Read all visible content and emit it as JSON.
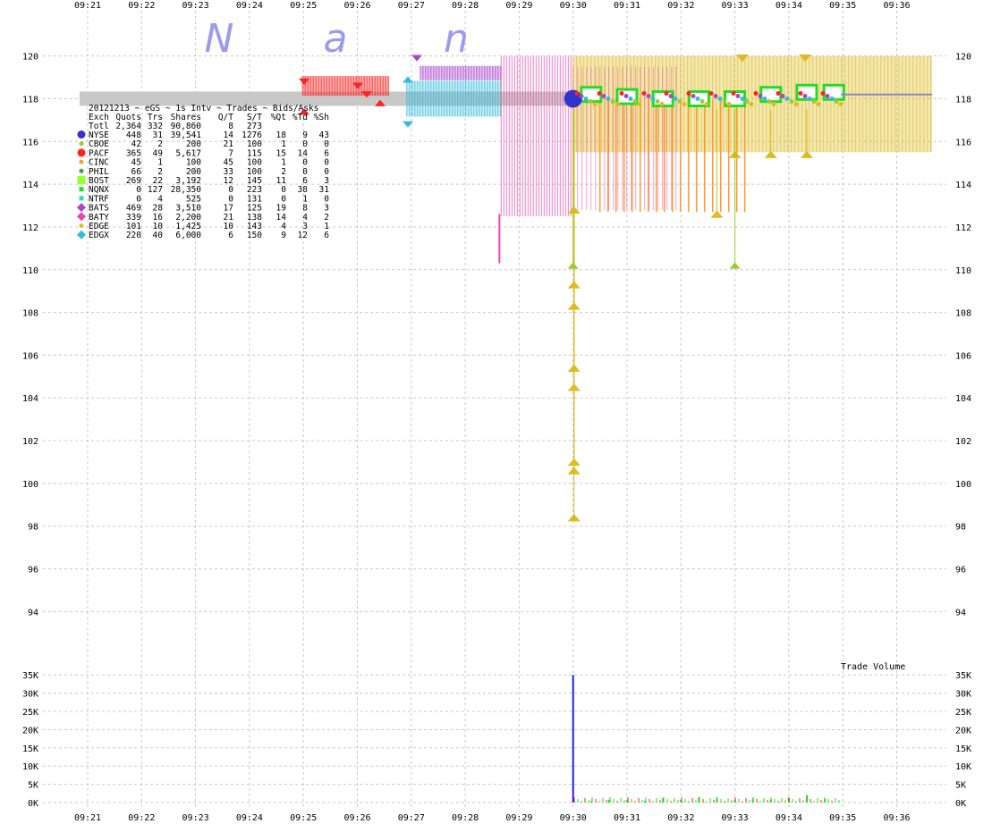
{
  "watermark_letters": [
    "N",
    "a",
    "n"
  ],
  "colors": {
    "NYSE": "#3333cc",
    "CBOE": "#99cc33",
    "PACF": "#ff2222",
    "CINC": "#ff9933",
    "PHIL": "#33aa33",
    "BOST": "#99ff33",
    "NQNX": "#22dd22",
    "NTRF": "#33ddaa",
    "BATS": "#aa44cc",
    "BATY": "#ee44aa",
    "EDGE": "#ddbb22",
    "EDGX": "#33bbdd",
    "nbbo_bar": "#c8c8c8",
    "volume": "#2222dd"
  },
  "legend": {
    "header": "20121213 ~ eGS ~ 1s Intv ~ Trades ~ Bids/Asks",
    "columns": [
      "Exch",
      "Quots",
      "Trs",
      "Shares",
      "Q/T",
      "S/T",
      "%Qt",
      "%Td",
      "%Sh"
    ],
    "total_row": [
      "Totl",
      "2,364",
      "332",
      "90,860",
      "8",
      "273",
      "",
      "",
      ""
    ],
    "rows": [
      {
        "exch": "NYSE",
        "marker": "circle-big",
        "values": [
          "448",
          "31",
          "39,541",
          "14",
          "1276",
          "18",
          "9",
          "43"
        ]
      },
      {
        "exch": "CBOE",
        "marker": "circle-small",
        "values": [
          "42",
          "2",
          "200",
          "21",
          "100",
          "1",
          "0",
          "0"
        ]
      },
      {
        "exch": "PACF",
        "marker": "circle-big",
        "values": [
          "365",
          "49",
          "5,617",
          "7",
          "115",
          "15",
          "14",
          "6"
        ]
      },
      {
        "exch": "CINC",
        "marker": "circle-small",
        "values": [
          "45",
          "1",
          "100",
          "45",
          "100",
          "1",
          "0",
          "0"
        ]
      },
      {
        "exch": "PHIL",
        "marker": "circle-small",
        "values": [
          "66",
          "2",
          "200",
          "33",
          "100",
          "2",
          "0",
          "0"
        ]
      },
      {
        "exch": "BOST",
        "marker": "square-big",
        "values": [
          "269",
          "22",
          "3,192",
          "12",
          "145",
          "11",
          "6",
          "3"
        ]
      },
      {
        "exch": "NQNX",
        "marker": "square-small",
        "values": [
          "0",
          "127",
          "28,350",
          "0",
          "223",
          "0",
          "38",
          "31"
        ]
      },
      {
        "exch": "NTRF",
        "marker": "square-small",
        "values": [
          "0",
          "4",
          "525",
          "0",
          "131",
          "0",
          "1",
          "0"
        ]
      },
      {
        "exch": "BATS",
        "marker": "diamond",
        "values": [
          "469",
          "28",
          "3,510",
          "17",
          "125",
          "19",
          "8",
          "3"
        ]
      },
      {
        "exch": "BATY",
        "marker": "diamond",
        "values": [
          "339",
          "16",
          "2,200",
          "21",
          "138",
          "14",
          "4",
          "2"
        ]
      },
      {
        "exch": "EDGE",
        "marker": "diamond-small",
        "values": [
          "101",
          "10",
          "1,425",
          "10",
          "143",
          "4",
          "3",
          "1"
        ]
      },
      {
        "exch": "EDGX",
        "marker": "diamond",
        "values": [
          "220",
          "40",
          "6,000",
          "6",
          "150",
          "9",
          "12",
          "6"
        ]
      }
    ]
  },
  "chart_data": [
    {
      "type": "scatter",
      "x_ticks": [
        "09:21",
        "09:22",
        "09:23",
        "09:24",
        "09:25",
        "09:26",
        "09:27",
        "09:28",
        "09:29",
        "09:30",
        "09:31",
        "09:32",
        "09:33",
        "09:34",
        "09:35",
        "09:36"
      ],
      "y_ticks": [
        "94",
        "96",
        "98",
        "100",
        "102",
        "104",
        "106",
        "108",
        "110",
        "112",
        "114",
        "116",
        "118",
        "120"
      ],
      "ylim": [
        92.3,
        121.7
      ],
      "grid": true,
      "series": [
        {
          "name": "NBBO",
          "type": "band",
          "points": [
            {
              "x": "09:20:51",
              "y": 118.0
            },
            {
              "x": "09:29:58",
              "y": 118.0
            }
          ]
        },
        {
          "name": "PACF",
          "type": "band",
          "points": [
            {
              "x": "09:24:59",
              "y": 118.6
            },
            {
              "x": "09:26:35",
              "y": 118.6
            }
          ]
        },
        {
          "name": "EDGX",
          "type": "band",
          "points": [
            {
              "x": "09:26:55",
              "y": 118.0
            },
            {
              "x": "09:28:40",
              "y": 118.0
            }
          ]
        },
        {
          "name": "BATS",
          "type": "band",
          "points": [
            {
              "x": "09:27:10",
              "y": 119.2
            },
            {
              "x": "09:28:40",
              "y": 119.2
            }
          ]
        },
        {
          "name": "BATY",
          "type": "band",
          "points": [
            {
              "x": "09:28:40",
              "y": 115.8
            },
            {
              "x": "09:30:00",
              "y": 115.8
            }
          ]
        },
        {
          "name": "EDGE",
          "type": "band",
          "points": [
            {
              "x": "09:30:00",
              "y": 117.5
            },
            {
              "x": "09:35:00",
              "y": 117.5
            }
          ]
        },
        {
          "name": "EDGE",
          "type": "trades",
          "points": [
            {
              "x": "09:30:01",
              "y": 112.8
            },
            {
              "x": "09:30:01",
              "y": 109.3
            },
            {
              "x": "09:30:01",
              "y": 108.3
            },
            {
              "x": "09:30:01",
              "y": 105.4
            },
            {
              "x": "09:30:01",
              "y": 104.5
            },
            {
              "x": "09:30:01",
              "y": 101.0
            },
            {
              "x": "09:30:01",
              "y": 100.6
            },
            {
              "x": "09:30:01",
              "y": 98.4
            },
            {
              "x": "09:33:00",
              "y": 115.4
            },
            {
              "x": "09:33:40",
              "y": 115.4
            },
            {
              "x": "09:34:20",
              "y": 115.4
            },
            {
              "x": "09:32:40",
              "y": 112.6
            }
          ]
        },
        {
          "name": "NQNX",
          "type": "trades",
          "points": [
            {
              "x": "09:30:20",
              "y": 118.2
            },
            {
              "x": "09:31:00",
              "y": 118.1
            },
            {
              "x": "09:31:40",
              "y": 118.0
            },
            {
              "x": "09:32:20",
              "y": 118.0
            },
            {
              "x": "09:33:00",
              "y": 118.0
            },
            {
              "x": "09:33:40",
              "y": 118.2
            },
            {
              "x": "09:34:20",
              "y": 118.3
            },
            {
              "x": "09:34:50",
              "y": 118.3
            }
          ]
        },
        {
          "name": "NYSE",
          "type": "trades",
          "points": [
            {
              "x": "09:30:00",
              "y": 118.0
            }
          ]
        },
        {
          "name": "CBOE",
          "type": "trades",
          "points": [
            {
              "x": "09:30:00",
              "y": 110.2
            },
            {
              "x": "09:33:00",
              "y": 110.2
            }
          ]
        }
      ]
    },
    {
      "type": "bar",
      "title": "Trade Volume",
      "y_ticks": [
        "0K",
        "5K",
        "10K",
        "15K",
        "20K",
        "25K",
        "30K",
        "35K"
      ],
      "ylim": [
        0,
        37500
      ],
      "x": [
        "09:30:00",
        "09:30:20",
        "09:30:40",
        "09:31:00",
        "09:31:20",
        "09:31:40",
        "09:32:00",
        "09:32:20",
        "09:32:40",
        "09:33:00",
        "09:33:20",
        "09:33:40",
        "09:34:00",
        "09:34:20",
        "09:34:40"
      ],
      "values": [
        35000,
        400,
        800,
        600,
        500,
        1200,
        700,
        1500,
        1300,
        800,
        1100,
        900,
        1200,
        2000,
        1000
      ]
    }
  ]
}
